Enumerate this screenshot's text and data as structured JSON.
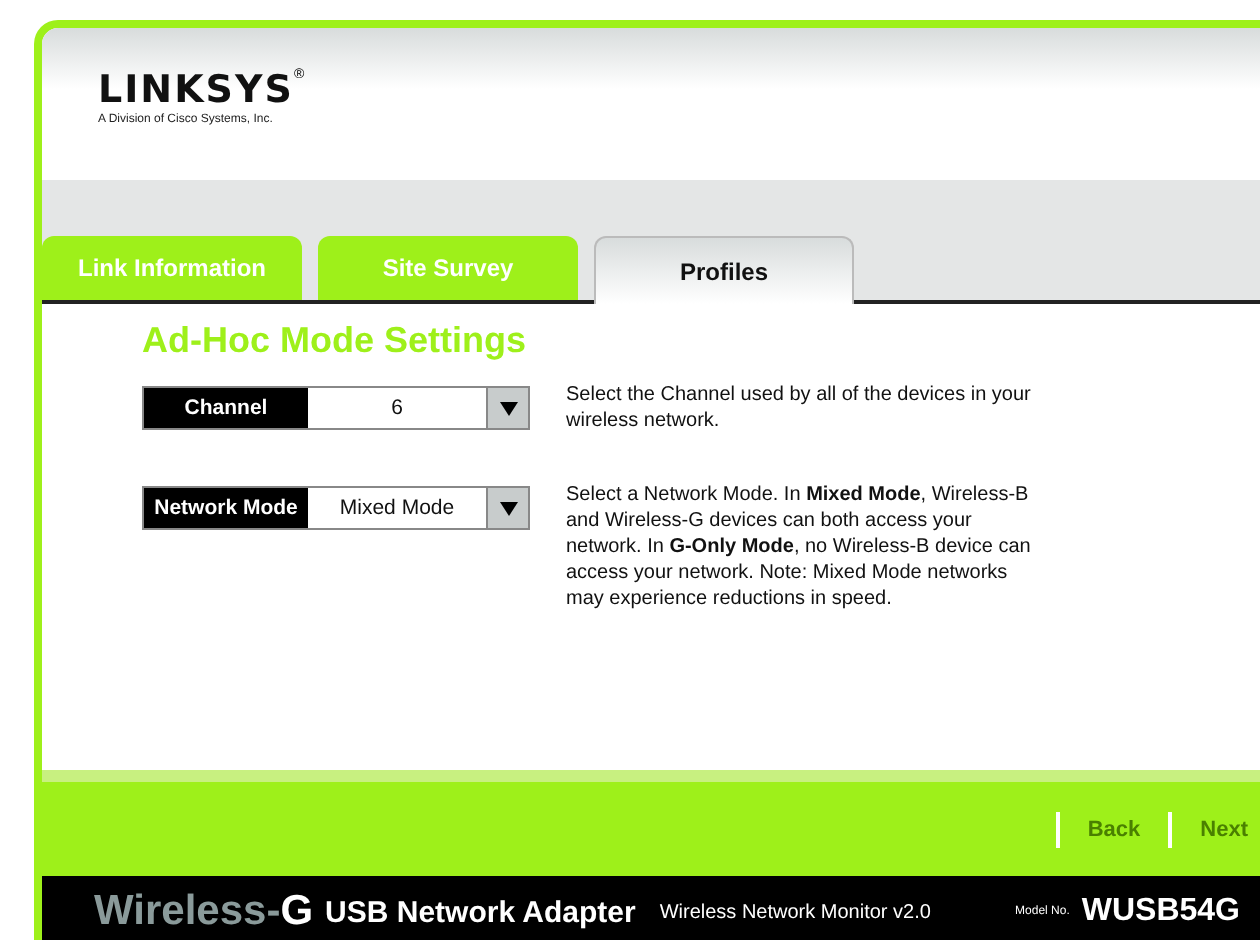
{
  "header": {
    "logo": "LINKSYS",
    "registered": "®",
    "tagline": "A Division of Cisco Systems, Inc."
  },
  "tabs": [
    {
      "label": "Link Information",
      "selected": false
    },
    {
      "label": "Site Survey",
      "selected": false
    },
    {
      "label": "Profiles",
      "selected": true
    }
  ],
  "section_title": "Ad-Hoc Mode Settings",
  "settings": [
    {
      "label": "Channel",
      "value": "6",
      "description": "Select the Channel used by all of the devices in your wireless network."
    },
    {
      "label": "Network Mode",
      "value": "Mixed Mode",
      "description": "Select a Network Mode. In **Mixed Mode**, Wireless-B and Wireless-G devices can both access your network. In **G-Only Mode**, no Wireless-B device can access your network. Note: Mixed Mode networks may experience reductions in speed."
    }
  ],
  "nav_buttons": [
    {
      "label": "Back",
      "disabled": true
    },
    {
      "label": "Next",
      "disabled": true
    }
  ],
  "footer": {
    "brand": "Wireless-**G**",
    "product": "USB Network Adapter",
    "app": "Wireless Network Monitor v2.0",
    "model_label": "Model No.",
    "model": "WUSB54G"
  }
}
